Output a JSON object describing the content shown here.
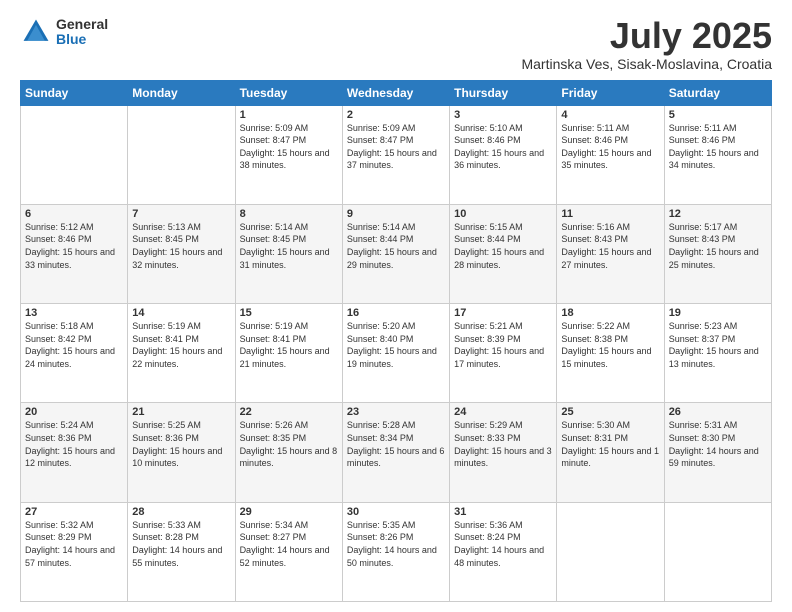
{
  "logo": {
    "general": "General",
    "blue": "Blue"
  },
  "title": "July 2025",
  "subtitle": "Martinska Ves, Sisak-Moslavina, Croatia",
  "days_header": [
    "Sunday",
    "Monday",
    "Tuesday",
    "Wednesday",
    "Thursday",
    "Friday",
    "Saturday"
  ],
  "weeks": [
    [
      {
        "day": "",
        "info": ""
      },
      {
        "day": "",
        "info": ""
      },
      {
        "day": "1",
        "info": "Sunrise: 5:09 AM\nSunset: 8:47 PM\nDaylight: 15 hours and 38 minutes."
      },
      {
        "day": "2",
        "info": "Sunrise: 5:09 AM\nSunset: 8:47 PM\nDaylight: 15 hours and 37 minutes."
      },
      {
        "day": "3",
        "info": "Sunrise: 5:10 AM\nSunset: 8:46 PM\nDaylight: 15 hours and 36 minutes."
      },
      {
        "day": "4",
        "info": "Sunrise: 5:11 AM\nSunset: 8:46 PM\nDaylight: 15 hours and 35 minutes."
      },
      {
        "day": "5",
        "info": "Sunrise: 5:11 AM\nSunset: 8:46 PM\nDaylight: 15 hours and 34 minutes."
      }
    ],
    [
      {
        "day": "6",
        "info": "Sunrise: 5:12 AM\nSunset: 8:46 PM\nDaylight: 15 hours and 33 minutes."
      },
      {
        "day": "7",
        "info": "Sunrise: 5:13 AM\nSunset: 8:45 PM\nDaylight: 15 hours and 32 minutes."
      },
      {
        "day": "8",
        "info": "Sunrise: 5:14 AM\nSunset: 8:45 PM\nDaylight: 15 hours and 31 minutes."
      },
      {
        "day": "9",
        "info": "Sunrise: 5:14 AM\nSunset: 8:44 PM\nDaylight: 15 hours and 29 minutes."
      },
      {
        "day": "10",
        "info": "Sunrise: 5:15 AM\nSunset: 8:44 PM\nDaylight: 15 hours and 28 minutes."
      },
      {
        "day": "11",
        "info": "Sunrise: 5:16 AM\nSunset: 8:43 PM\nDaylight: 15 hours and 27 minutes."
      },
      {
        "day": "12",
        "info": "Sunrise: 5:17 AM\nSunset: 8:43 PM\nDaylight: 15 hours and 25 minutes."
      }
    ],
    [
      {
        "day": "13",
        "info": "Sunrise: 5:18 AM\nSunset: 8:42 PM\nDaylight: 15 hours and 24 minutes."
      },
      {
        "day": "14",
        "info": "Sunrise: 5:19 AM\nSunset: 8:41 PM\nDaylight: 15 hours and 22 minutes."
      },
      {
        "day": "15",
        "info": "Sunrise: 5:19 AM\nSunset: 8:41 PM\nDaylight: 15 hours and 21 minutes."
      },
      {
        "day": "16",
        "info": "Sunrise: 5:20 AM\nSunset: 8:40 PM\nDaylight: 15 hours and 19 minutes."
      },
      {
        "day": "17",
        "info": "Sunrise: 5:21 AM\nSunset: 8:39 PM\nDaylight: 15 hours and 17 minutes."
      },
      {
        "day": "18",
        "info": "Sunrise: 5:22 AM\nSunset: 8:38 PM\nDaylight: 15 hours and 15 minutes."
      },
      {
        "day": "19",
        "info": "Sunrise: 5:23 AM\nSunset: 8:37 PM\nDaylight: 15 hours and 13 minutes."
      }
    ],
    [
      {
        "day": "20",
        "info": "Sunrise: 5:24 AM\nSunset: 8:36 PM\nDaylight: 15 hours and 12 minutes."
      },
      {
        "day": "21",
        "info": "Sunrise: 5:25 AM\nSunset: 8:36 PM\nDaylight: 15 hours and 10 minutes."
      },
      {
        "day": "22",
        "info": "Sunrise: 5:26 AM\nSunset: 8:35 PM\nDaylight: 15 hours and 8 minutes."
      },
      {
        "day": "23",
        "info": "Sunrise: 5:28 AM\nSunset: 8:34 PM\nDaylight: 15 hours and 6 minutes."
      },
      {
        "day": "24",
        "info": "Sunrise: 5:29 AM\nSunset: 8:33 PM\nDaylight: 15 hours and 3 minutes."
      },
      {
        "day": "25",
        "info": "Sunrise: 5:30 AM\nSunset: 8:31 PM\nDaylight: 15 hours and 1 minute."
      },
      {
        "day": "26",
        "info": "Sunrise: 5:31 AM\nSunset: 8:30 PM\nDaylight: 14 hours and 59 minutes."
      }
    ],
    [
      {
        "day": "27",
        "info": "Sunrise: 5:32 AM\nSunset: 8:29 PM\nDaylight: 14 hours and 57 minutes."
      },
      {
        "day": "28",
        "info": "Sunrise: 5:33 AM\nSunset: 8:28 PM\nDaylight: 14 hours and 55 minutes."
      },
      {
        "day": "29",
        "info": "Sunrise: 5:34 AM\nSunset: 8:27 PM\nDaylight: 14 hours and 52 minutes."
      },
      {
        "day": "30",
        "info": "Sunrise: 5:35 AM\nSunset: 8:26 PM\nDaylight: 14 hours and 50 minutes."
      },
      {
        "day": "31",
        "info": "Sunrise: 5:36 AM\nSunset: 8:24 PM\nDaylight: 14 hours and 48 minutes."
      },
      {
        "day": "",
        "info": ""
      },
      {
        "day": "",
        "info": ""
      }
    ]
  ]
}
